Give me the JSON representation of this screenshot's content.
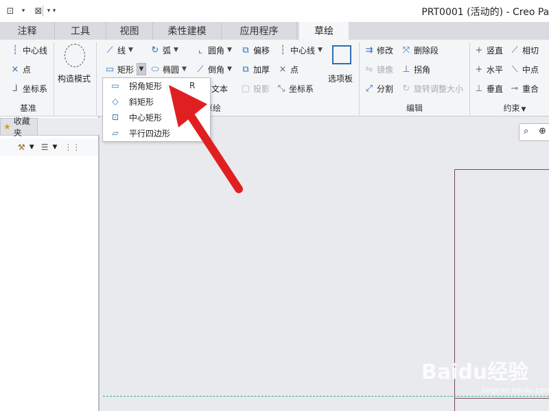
{
  "window": {
    "title": "PRT0001 (活动的) - Creo Par"
  },
  "quick_access": [
    "⊡",
    "▾",
    "⊠",
    "▾",
    "▾"
  ],
  "tabs": [
    "注释",
    "工具",
    "视图",
    "柔性建模",
    "应用程序",
    "草绘"
  ],
  "ribbon": {
    "datum": {
      "label": "基准",
      "items": [
        "中心线",
        "点",
        "坐标系"
      ]
    },
    "construction": {
      "label": "构造模式"
    },
    "sketch": {
      "label": "草绘",
      "line": "线",
      "arc": "弧",
      "fillet": "圆角",
      "offset": "偏移",
      "centerline": "中心线",
      "rect": "矩形",
      "ellipse": "椭圆",
      "chamfer": "倒角",
      "thicken": "加厚",
      "point": "点",
      "text_partial": "文本",
      "project": "投影",
      "coord": "坐标系"
    },
    "palette": "选项板",
    "edit": {
      "label": "编辑",
      "modify": "修改",
      "delete_seg": "删除段",
      "mirror": "镜像",
      "corner": "拐角",
      "divide": "分割",
      "rotate_resize": "旋转调整大小"
    },
    "constrain": {
      "label": "约束",
      "vertical": "竖直",
      "tangent": "相切",
      "horizontal": "水平",
      "midpoint": "中点",
      "perpendicular": "垂直",
      "coincident": "重合"
    }
  },
  "rect_menu": [
    {
      "label": "拐角矩形",
      "shortcut": "R"
    },
    {
      "label": "斜矩形",
      "shortcut": ""
    },
    {
      "label": "中心矩形",
      "shortcut": ""
    },
    {
      "label": "平行四边形",
      "shortcut": ""
    }
  ],
  "left_panel": {
    "tab": "收藏夹"
  },
  "watermark": {
    "main": "Baidu经验",
    "sub": "jingyan.baidu.com"
  },
  "colors": {
    "arrow": "#e02020",
    "accent": "#2a6fb5",
    "sketch_line": "#7a4a52",
    "dashed": "#3aa58a"
  }
}
